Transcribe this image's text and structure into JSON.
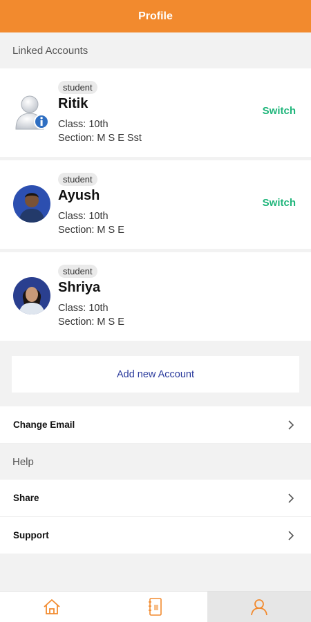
{
  "header": {
    "title": "Profile"
  },
  "linked_label": "Linked Accounts",
  "accounts": [
    {
      "role": "student",
      "name": "Ritik",
      "class": "Class: 10th",
      "section": "Section: M S E Sst",
      "action": "Switch",
      "avatar": "default-user-icon"
    },
    {
      "role": "student",
      "name": "Ayush",
      "class": "Class: 10th",
      "section": "Section: M S E",
      "action": "Switch",
      "avatar": "user-photo"
    },
    {
      "role": "student",
      "name": "Shriya",
      "class": "Class: 10th",
      "section": "Section: M S E",
      "action": "",
      "avatar": "user-photo"
    }
  ],
  "add_account_label": "Add new Account",
  "change_email_label": "Change Email",
  "help_label": "Help",
  "help_items": [
    {
      "label": "Share"
    },
    {
      "label": "Support"
    }
  ],
  "tabs": [
    {
      "icon": "home-icon",
      "active": false
    },
    {
      "icon": "notebook-icon",
      "active": false
    },
    {
      "icon": "profile-icon",
      "active": true
    }
  ],
  "colors": {
    "accent": "#f28a2e",
    "switch": "#1eb57a",
    "link": "#2a3a9c"
  }
}
